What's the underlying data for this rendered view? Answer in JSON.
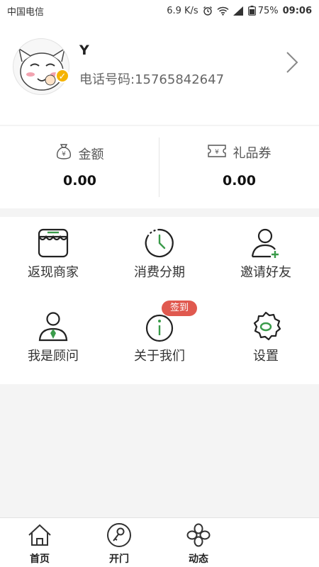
{
  "status_bar": {
    "carrier": "中国电信",
    "speed": "6.9 K/s",
    "battery": "75%",
    "time": "09:06"
  },
  "profile": {
    "name": "Y",
    "phone": "电话号码:15765842647"
  },
  "wallet": {
    "amount_label": "金额",
    "amount_value": "0.00",
    "voucher_label": "礼品券",
    "voucher_value": "0.00"
  },
  "menu": [
    {
      "label": "返现商家",
      "icon": "store-icon"
    },
    {
      "label": "消费分期",
      "icon": "clock-icon"
    },
    {
      "label": "邀请好友",
      "icon": "add-user-icon"
    },
    {
      "label": "我是顾问",
      "icon": "consultant-icon"
    },
    {
      "label": "关于我们",
      "icon": "info-icon",
      "badge": "签到"
    },
    {
      "label": "设置",
      "icon": "gear-icon"
    }
  ],
  "tabs": [
    {
      "label": "首页",
      "icon": "home-icon"
    },
    {
      "label": "开门",
      "icon": "key-icon"
    },
    {
      "label": "动态",
      "icon": "clover-icon"
    }
  ],
  "colors": {
    "accent_green": "#3a9b4a",
    "badge_red": "#e0594f",
    "verified_gold": "#f5b300"
  }
}
